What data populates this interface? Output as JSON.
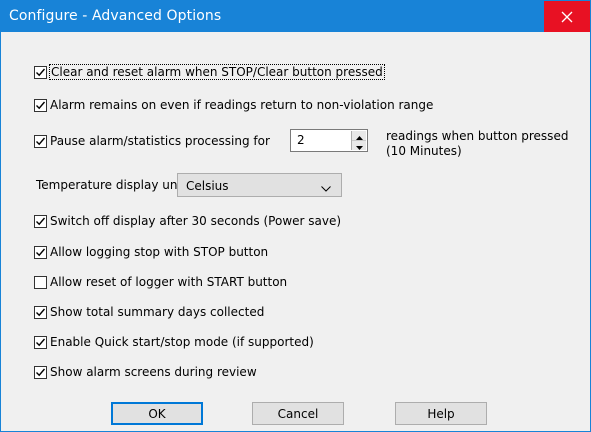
{
  "window": {
    "title": "Configure - Advanced Options",
    "close_icon": "close-icon"
  },
  "options": [
    {
      "label": "Clear and reset alarm when STOP/Clear button pressed",
      "checked": true
    },
    {
      "label": "Alarm remains on even if readings return to non-violation range",
      "checked": true
    },
    {
      "label": "Pause alarm/statistics processing for",
      "checked": true
    },
    {
      "label": "Switch off display after 30 seconds (Power save)",
      "checked": true
    },
    {
      "label": "Allow logging stop with STOP button",
      "checked": true
    },
    {
      "label": "Allow reset of logger with START button",
      "checked": false
    },
    {
      "label": "Show total summary days collected",
      "checked": true
    },
    {
      "label": "Enable Quick start/stop mode (if supported)",
      "checked": true
    },
    {
      "label": "Show alarm screens during review",
      "checked": true
    }
  ],
  "pause": {
    "value": "2",
    "note": "readings when button pressed (10 Minutes)"
  },
  "temperature": {
    "label": "Temperature display unit:",
    "selected": "Celsius"
  },
  "buttons": {
    "ok": "OK",
    "cancel": "Cancel",
    "help": "Help"
  },
  "colors": {
    "titlebar": "#1883d7",
    "close": "#e81123",
    "dialog_bg": "#f0f0f0"
  }
}
